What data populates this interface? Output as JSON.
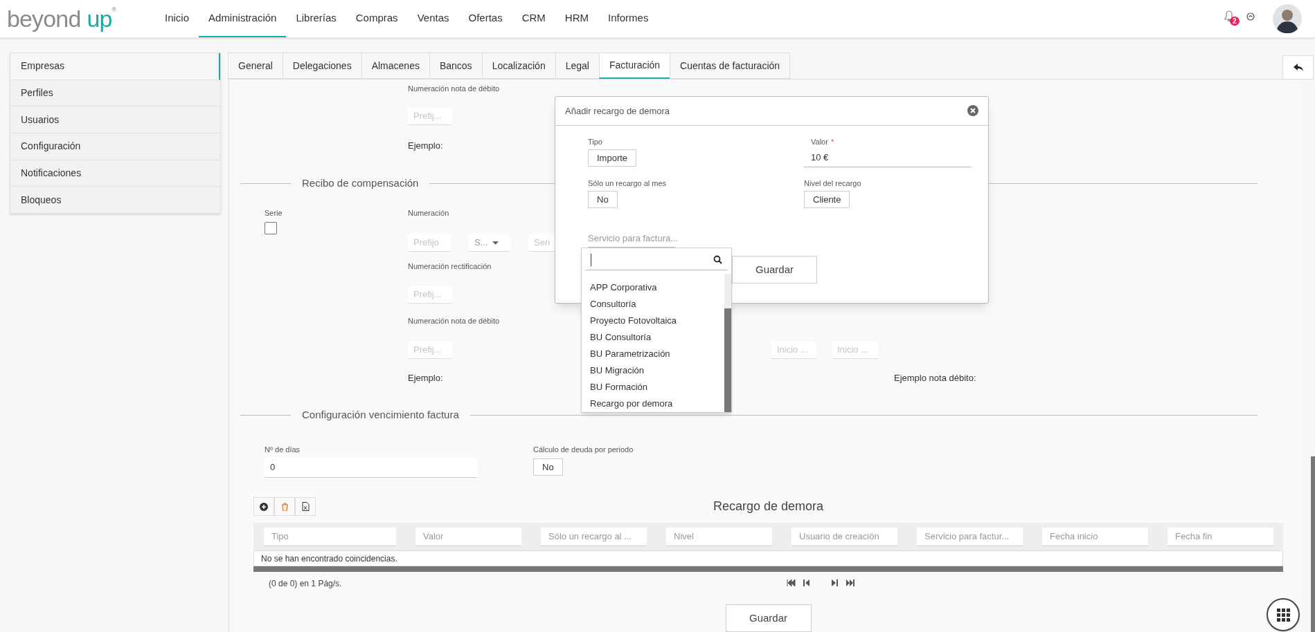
{
  "header": {
    "logo": {
      "text": "beyond",
      "accent": "up",
      "mark": "®"
    },
    "nav": [
      {
        "label": "Inicio",
        "selected": false
      },
      {
        "label": "Administración",
        "selected": true
      },
      {
        "label": "Librerías",
        "selected": false
      },
      {
        "label": "Compras",
        "selected": false
      },
      {
        "label": "Ventas",
        "selected": false
      },
      {
        "label": "Ofertas",
        "selected": false
      },
      {
        "label": "CRM",
        "selected": false
      },
      {
        "label": "HRM",
        "selected": false
      },
      {
        "label": "Informes",
        "selected": false
      }
    ],
    "notifications": {
      "count": "2"
    }
  },
  "sidebar": {
    "items": [
      {
        "label": "Empresas",
        "selected": true
      },
      {
        "label": "Perfiles",
        "selected": false
      },
      {
        "label": "Usuarios",
        "selected": false
      },
      {
        "label": "Configuración",
        "selected": false
      },
      {
        "label": "Notificaciones",
        "selected": false
      },
      {
        "label": "Bloqueos",
        "selected": false
      }
    ]
  },
  "tabs": [
    {
      "label": "General",
      "selected": false
    },
    {
      "label": "Delegaciones",
      "selected": false
    },
    {
      "label": "Almacenes",
      "selected": false
    },
    {
      "label": "Bancos",
      "selected": false
    },
    {
      "label": "Localización",
      "selected": false
    },
    {
      "label": "Legal",
      "selected": false
    },
    {
      "label": "Facturación",
      "selected": true
    },
    {
      "label": "Cuentas de facturación",
      "selected": false
    }
  ],
  "top_block": {
    "numbering_label": "Numeración nota de débito",
    "prefix": {
      "placeholder": "Prefij..."
    },
    "example_label": "Ejemplo:"
  },
  "compensation_receipt": {
    "title": "Recibo de compensación",
    "serie_label": "Serie",
    "serie_checked": false,
    "numbering_label": "Numeración",
    "prefix": {
      "placeholder": "Prefijo"
    },
    "series_select": {
      "placeholder": "S..."
    },
    "series_field": {
      "placeholder": "Seri"
    },
    "rectification_label": "Numeración rectificación",
    "rectification_prefix": {
      "placeholder": "Prefij..."
    },
    "debit_label": "Numeración nota de débito",
    "debit_prefix": {
      "placeholder": "Prefij..."
    },
    "debit_start_fields": [
      {
        "placeholder": "Inicio ..."
      },
      {
        "placeholder": "Inicio ..."
      }
    ],
    "example_label": "Ejemplo:",
    "debit_example_label": "Ejemplo nota débito:"
  },
  "due_config": {
    "title": "Configuración vencimiento factura",
    "days_label": "Nº de días",
    "days": {
      "value": "0"
    },
    "debt_calc_label": "Cálculo de deuda por periodo",
    "debt_calc": "No"
  },
  "late_fees_table": {
    "title": "Recargo de demora",
    "columns": [
      {
        "placeholder": "Tipo"
      },
      {
        "placeholder": "Valor"
      },
      {
        "placeholder": "Sólo un recargo al ..."
      },
      {
        "placeholder": "Nivel"
      },
      {
        "placeholder": "Usuario de creación"
      },
      {
        "placeholder": "Servicio para factur..."
      },
      {
        "placeholder": "Fecha inicio"
      },
      {
        "placeholder": "Fecha fin"
      }
    ],
    "empty_message": "No se han encontrado coincidencias.",
    "pager": "(0 de 0) en 1 Pág/s."
  },
  "save_button": "Guardar",
  "modal": {
    "title": "Añadir recargo de demora",
    "fields": [
      {
        "kind": "toggle",
        "label": "Tipo",
        "value": "Importe"
      },
      {
        "kind": "text",
        "label": "Valor",
        "required_mark": "*",
        "value": "10 €"
      },
      {
        "kind": "toggle",
        "label": "Sólo un recargo al mes",
        "value": "No"
      },
      {
        "kind": "toggle",
        "label": "Nivel del recargo",
        "value": "Cliente"
      }
    ],
    "service": {
      "placeholder": "Servicio para factura..."
    },
    "save_button": "Guardar",
    "dropdown": {
      "options": [
        "APP Corporativa",
        "Consultoría",
        "Proyecto Fotovoltaica",
        "BU Consultoría",
        "BU Parametrización",
        "BU Migración",
        "BU Formación",
        "Recargo por demora"
      ]
    }
  }
}
